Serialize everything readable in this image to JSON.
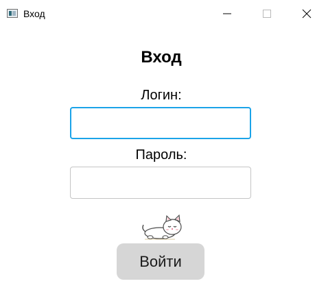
{
  "window": {
    "title": "Вход",
    "controls": {
      "minimize_icon": "minimize-icon",
      "maximize_icon": "maximize-icon",
      "close_icon": "close-icon"
    }
  },
  "form": {
    "heading": "Вход",
    "login_label": "Логин:",
    "login_value": "",
    "password_label": "Пароль:",
    "password_value": "",
    "submit_label": "Войти",
    "mascot": "sleeping-cat-image"
  },
  "colors": {
    "focus_border": "#1aa3e8",
    "field_border": "#c4c4c4",
    "button_bg": "#d6d6d6"
  }
}
